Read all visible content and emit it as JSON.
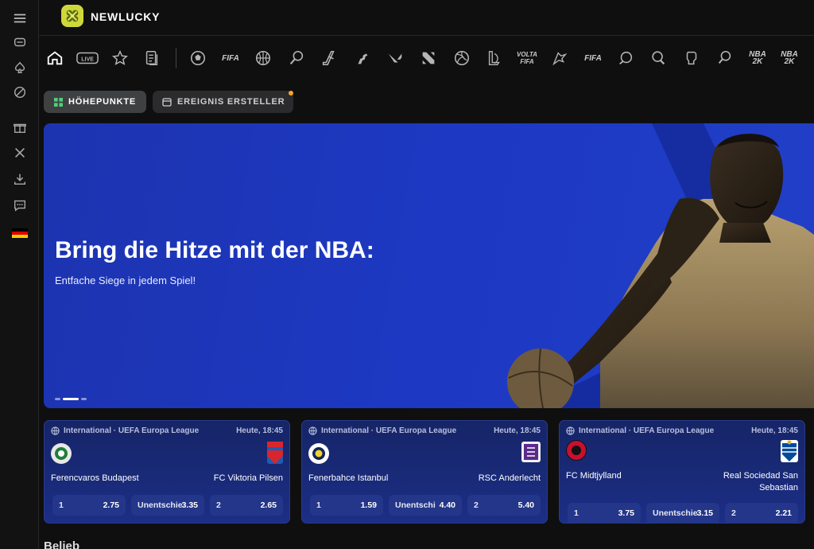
{
  "brand": {
    "name": "NEWLUCKY",
    "logo_icon": "clover-icon",
    "logo_color": "#cfd83a"
  },
  "sidebar": {
    "items": [
      {
        "name": "menu-icon"
      },
      {
        "name": "casino-icon"
      },
      {
        "name": "poker-spade-icon"
      },
      {
        "name": "sports-ball-icon"
      },
      {
        "name": "gift-icon"
      },
      {
        "name": "crossed-swords-icon"
      },
      {
        "name": "download-icon"
      },
      {
        "name": "chat-icon"
      },
      {
        "name": "language-flag-de"
      }
    ]
  },
  "sports_nav": {
    "items": [
      {
        "name": "home",
        "label": ""
      },
      {
        "name": "live",
        "label": "LIVE"
      },
      {
        "name": "favorites",
        "label": ""
      },
      {
        "name": "betslip",
        "label": ""
      },
      {
        "name": "soccer",
        "label": ""
      },
      {
        "name": "fifa24",
        "label": "FIFA"
      },
      {
        "name": "basketball",
        "label": ""
      },
      {
        "name": "tennis",
        "label": ""
      },
      {
        "name": "hockey",
        "label": ""
      },
      {
        "name": "counter-strike",
        "label": ""
      },
      {
        "name": "valorant",
        "label": ""
      },
      {
        "name": "dota",
        "label": ""
      },
      {
        "name": "volleyball",
        "label": ""
      },
      {
        "name": "league-of-legends",
        "label": ""
      },
      {
        "name": "volta-fifa",
        "label": "VOLTA FIFA"
      },
      {
        "name": "rocket-league",
        "label": ""
      },
      {
        "name": "penalty-fifa",
        "label": "FIFA"
      },
      {
        "name": "efootball",
        "label": ""
      },
      {
        "name": "table-tennis",
        "label": ""
      },
      {
        "name": "boxing",
        "label": ""
      },
      {
        "name": "tennis-24",
        "label": ""
      },
      {
        "name": "nba2k",
        "label": "NBA 2K"
      },
      {
        "name": "nba2k-extra",
        "label": "NBA 2K"
      }
    ]
  },
  "tabs": [
    {
      "label": "HÖHEPUNKTE",
      "icon": "grid-icon"
    },
    {
      "label": "EREIGNIS ERSTELLER",
      "icon": "calendar-icon"
    }
  ],
  "banner": {
    "title": "Bring die Hitze mit der NBA:",
    "subtitle": "Entfache Siege in jedem Spiel!",
    "slide_count": 3,
    "active_slide": 2
  },
  "matches": [
    {
      "league": "International · UEFA Europa League",
      "time": "Heute, 18:45",
      "home": "Ferencvaros Budapest",
      "away": "FC Viktoria Pilsen",
      "odds": [
        {
          "label": "1",
          "value": "2.75"
        },
        {
          "label": "Unentschie",
          "value": "3.35"
        },
        {
          "label": "2",
          "value": "2.65"
        }
      ]
    },
    {
      "league": "International · UEFA Europa League",
      "time": "Heute, 18:45",
      "home": "Fenerbahce Istanbul",
      "away": "RSC Anderlecht",
      "odds": [
        {
          "label": "1",
          "value": "1.59"
        },
        {
          "label": "Unentschi",
          "value": "4.40"
        },
        {
          "label": "2",
          "value": "5.40"
        }
      ]
    },
    {
      "league": "International · UEFA Europa League",
      "time": "Heute, 18:45",
      "home": "FC Midtjylland",
      "away": "Real Sociedad San Sebastian",
      "odds": [
        {
          "label": "1",
          "value": "3.75"
        },
        {
          "label": "Unentschie",
          "value": "3.15"
        },
        {
          "label": "2",
          "value": "2.21"
        }
      ]
    }
  ],
  "section": {
    "title": "Belieb"
  },
  "colors": {
    "accent": "#f4a62a",
    "banner": "#1d39c4",
    "card": "#1c2e86"
  }
}
